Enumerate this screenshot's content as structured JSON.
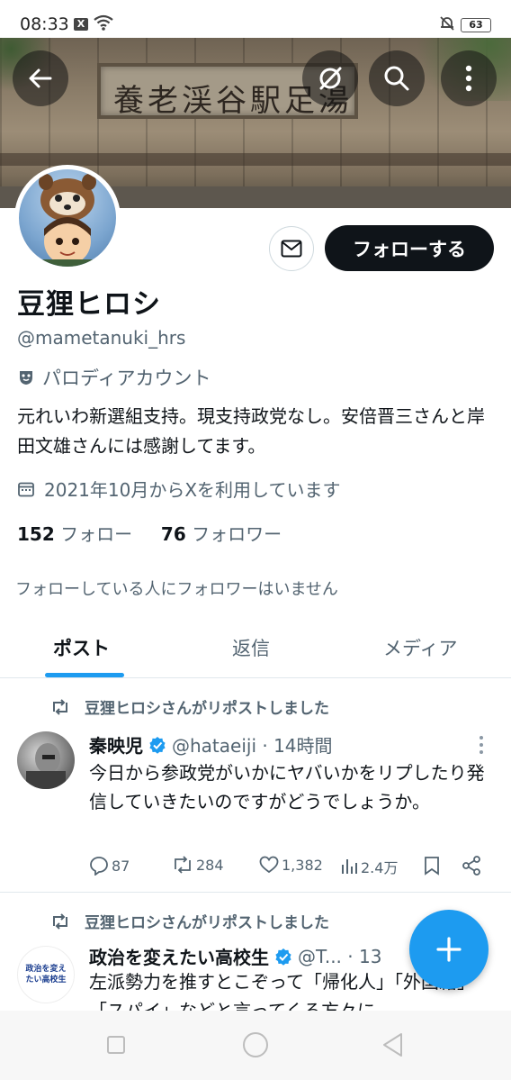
{
  "status_bar": {
    "time": "08:33",
    "battery": "63"
  },
  "banner": {
    "sign_text": "養老渓谷駅足湯"
  },
  "profile": {
    "name": "豆狸ヒロシ",
    "handle": "@mametanuki_hrs",
    "parody_label": "パロディアカウント",
    "bio": "元れいわ新選組支持。現支持政党なし。安倍晋三さんと岸田文雄さんには感謝してます。",
    "joined": "2021年10月からXを利用しています",
    "following_count": "152",
    "following_label": "フォロー",
    "followers_count": "76",
    "followers_label": "フォロワー",
    "no_followers_you_know": "フォローしている人にフォロワーはいません",
    "follow_button": "フォローする"
  },
  "tabs": [
    {
      "label": "ポスト",
      "active": true
    },
    {
      "label": "返信",
      "active": false
    },
    {
      "label": "メディア",
      "active": false
    }
  ],
  "posts": [
    {
      "repost_label": "豆狸ヒロシさんがリポストしました",
      "author": "秦映児",
      "handle_time": "@hataeiji · 14時間",
      "text": "今日から参政党がいかにヤバいかをリプしたり発信していきたいのですがどうでしょうか。",
      "replies": "87",
      "reposts": "284",
      "likes": "1,382",
      "views": "2.4万"
    },
    {
      "repost_label": "豆狸ヒロシさんがリポストしました",
      "author": "政治を変えたい高校生",
      "handle_time": "@T... · 13",
      "avatar_text": "政治を変えたい高校生",
      "text": "左派勢力を推すとこぞって「帰化人」「外国籍」「スパイ」などと言ってくる方々に"
    }
  ],
  "colors": {
    "accent": "#1d9bf0",
    "text": "#0f1419",
    "muted": "#536471"
  }
}
